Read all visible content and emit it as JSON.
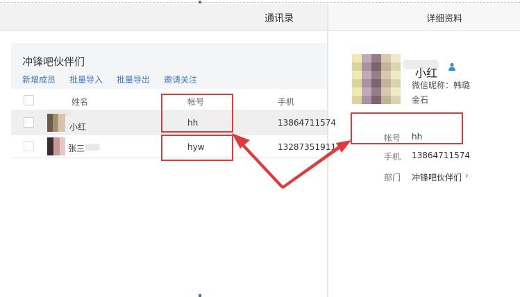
{
  "header": {
    "left_title": "通讯录",
    "right_title": "详细资料"
  },
  "group": {
    "title": "冲锋吧伙伴们",
    "actions": [
      "新增成员",
      "批量导入",
      "批量导出",
      "邀请关注"
    ]
  },
  "table": {
    "columns": [
      "姓名",
      "帐号",
      "手机"
    ],
    "rows": [
      {
        "name": "小红",
        "account": "hh",
        "phone": "13864711574"
      },
      {
        "name": "张三",
        "account": "hyw",
        "phone": "13287351911"
      }
    ]
  },
  "detail": {
    "name": "小红",
    "wechat_nickname": "微信昵称：韩璐",
    "company": "金石",
    "fields": [
      {
        "label": "帐号",
        "value": "hh"
      },
      {
        "label": "手机",
        "value": "13864711574"
      },
      {
        "label": "部门",
        "value": "冲锋吧伙伴们"
      }
    ],
    "chevron": "›"
  },
  "icons": {
    "person": "person-icon",
    "chevron": "chevron-right-icon"
  },
  "colors": {
    "accent_link": "#3a77c9",
    "highlight_red": "#e23a3a"
  }
}
